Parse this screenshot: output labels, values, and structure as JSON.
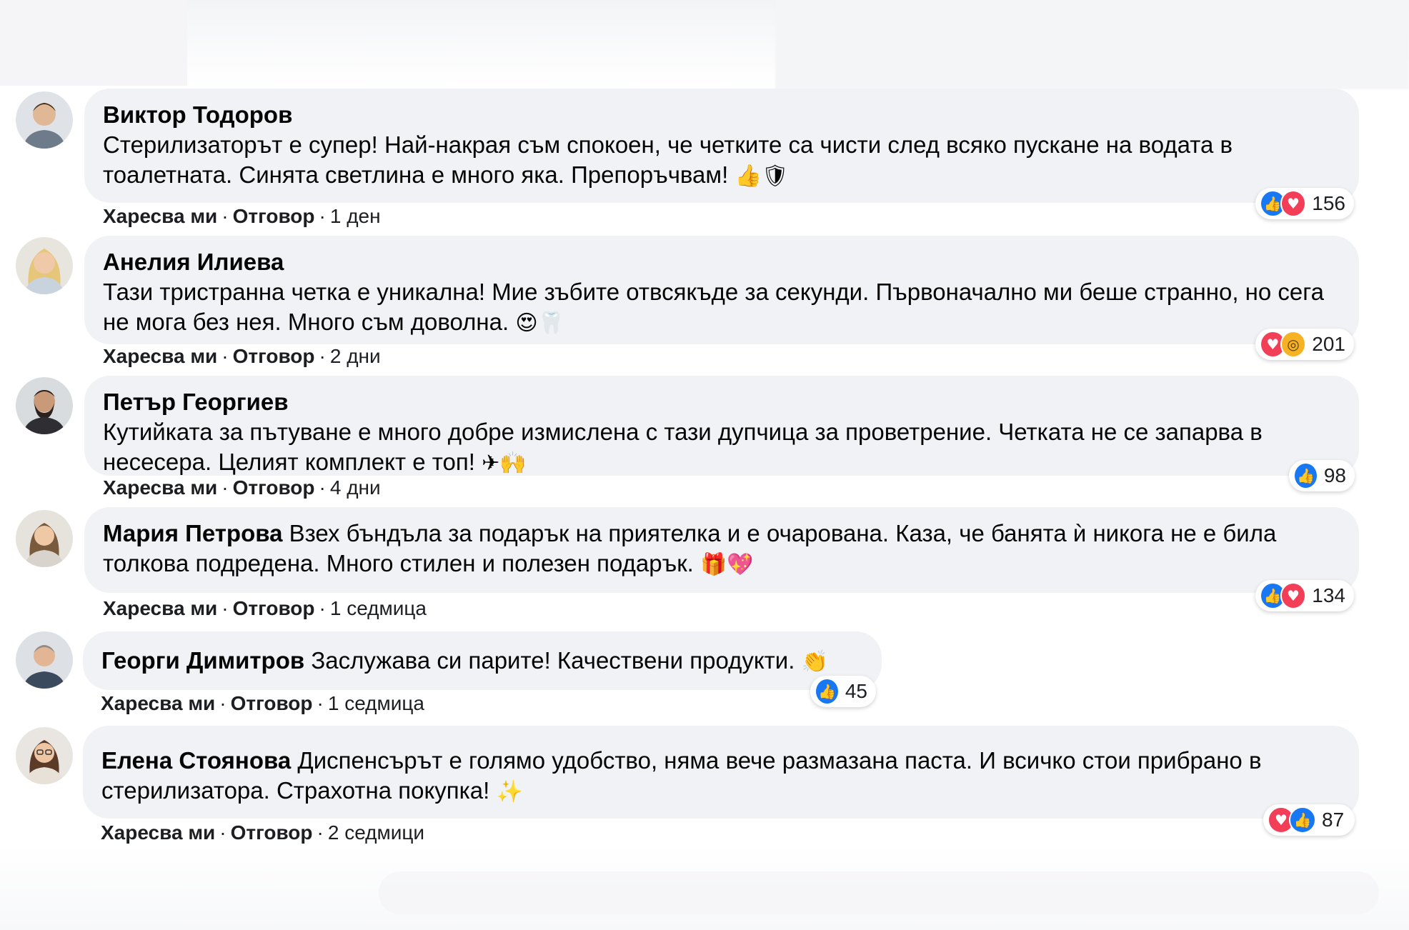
{
  "actions": {
    "like": "Харесва ми",
    "reply": "Отговор"
  },
  "comments": [
    {
      "author": "Виктор Тодоров",
      "text": "Стерилизаторът е супер! Най-накрая съм спокоен, че четките са чисти след всяко пускане на водата в тоалетната. Синята светлина е много яка. Препоръчвам!",
      "emoji": "👍🛡",
      "time": "1 ден",
      "reactions": [
        "like",
        "love"
      ],
      "reaction_count": "156"
    },
    {
      "author": "Анелия Илиева",
      "text": "Тази тристранна четка е уникална! Мие зъбите отвсякъде за секунди. Първоначално ми беше странно, но сега не мога без нея. Много съм доволна.",
      "emoji": "😍🦷",
      "time": "2 дни",
      "reactions": [
        "love",
        "wow"
      ],
      "reaction_count": "201"
    },
    {
      "author": "Петър Георгиев",
      "text": "Кутийката за пътуване е много добре измислена с тази дупчица за проветрение. Четката не се запарва в несесера. Целият комплект е топ!",
      "emoji": "✈🙌",
      "time": "4 дни",
      "reactions": [
        "like"
      ],
      "reaction_count": "98"
    },
    {
      "author": "Мария Петрова",
      "text": "Взех бъндъла за подарък на приятелка и е очарована. Каза, че банята ѝ никога не е била толкова подредена. Много стилен и полезен подарък.",
      "emoji": "🎁💖",
      "time": "1 седмица",
      "reactions": [
        "like",
        "love"
      ],
      "reaction_count": "134"
    },
    {
      "author": "Георги Димитров",
      "text": "Заслужава си парите! Качествени продукти.",
      "emoji": "👏",
      "time": "1 седмица",
      "reactions": [
        "like"
      ],
      "reaction_count": "45"
    },
    {
      "author": "Елена Стоянова",
      "text": "Диспенсърът е голямо удобство, няма вече размазана паста. И всичко стои прибрано в стерилизатора. Страхотна покупка!",
      "emoji": "✨",
      "time": "2 седмици",
      "reactions": [
        "love",
        "like"
      ],
      "reaction_count": "87"
    }
  ],
  "colors": {
    "bubble": "#f0f2f5",
    "like": "#1877f2",
    "love": "#f33e58",
    "wow": "#f7b125"
  }
}
